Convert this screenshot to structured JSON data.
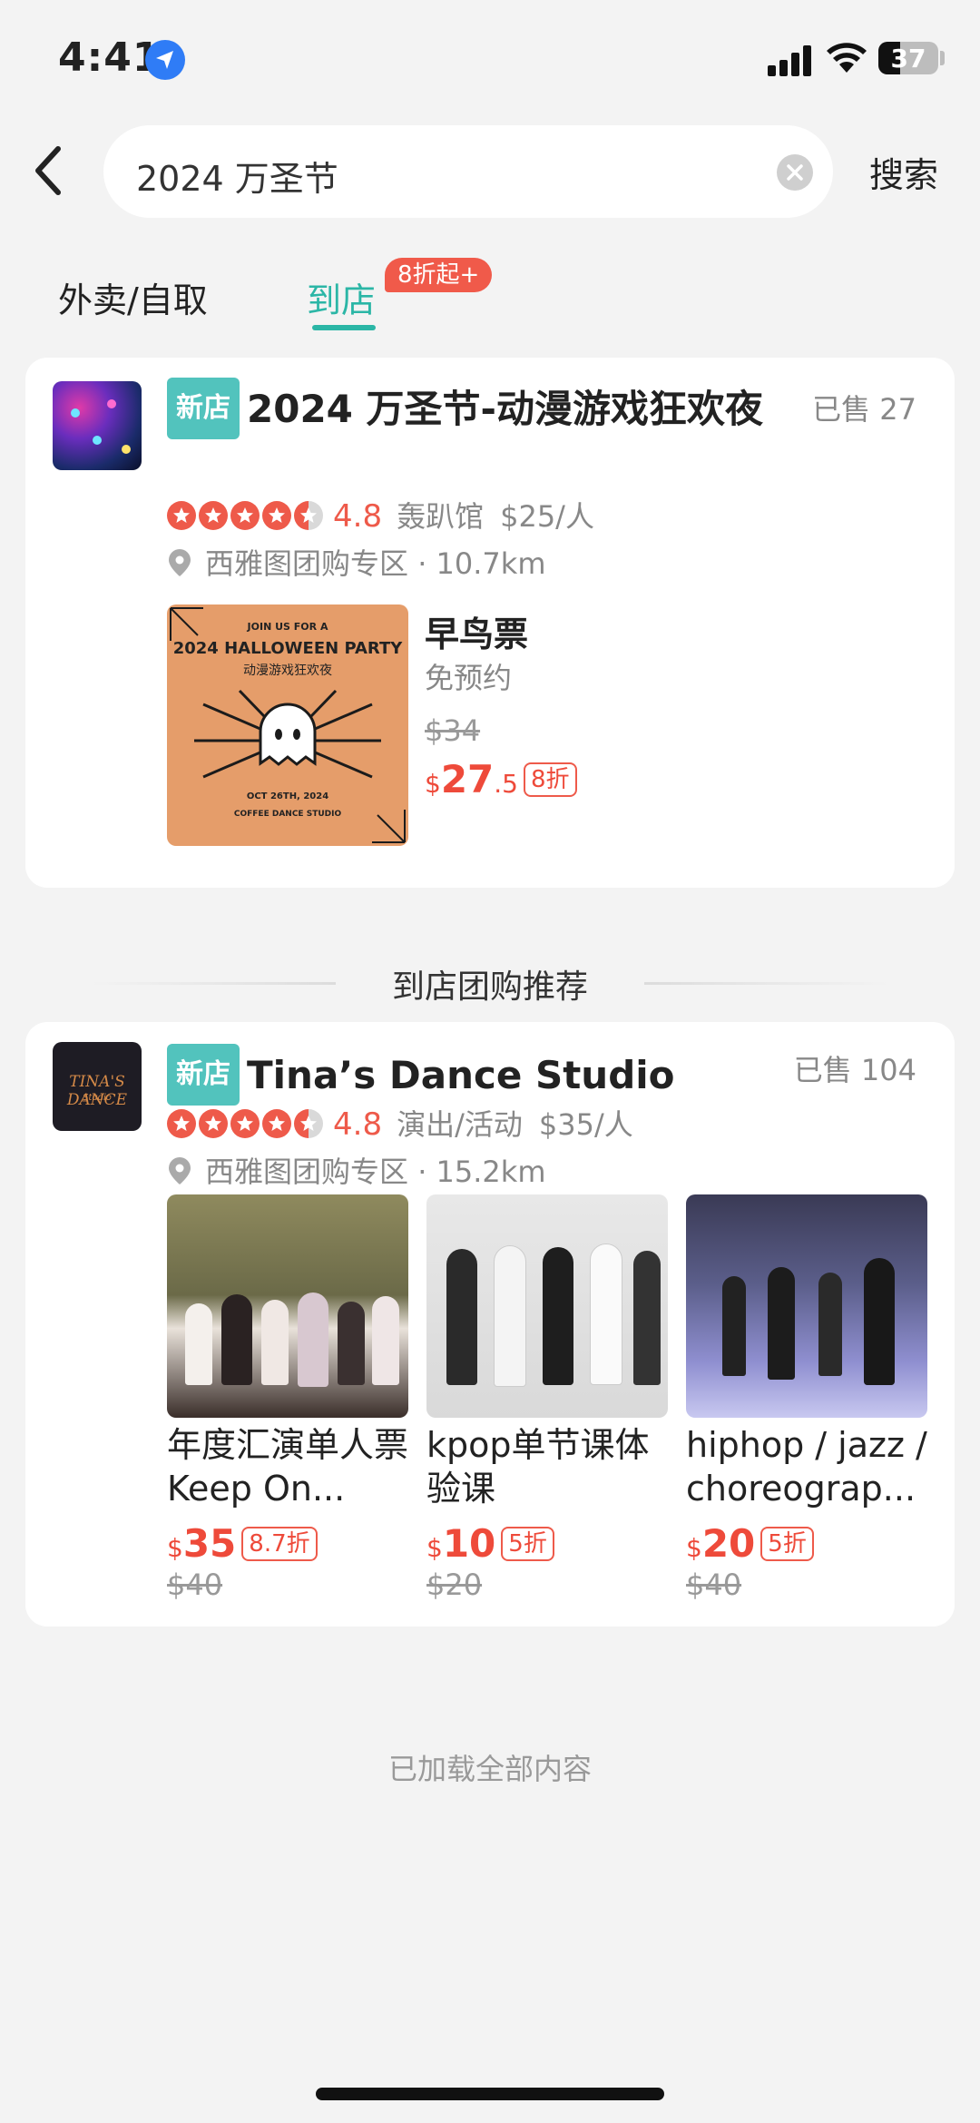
{
  "status_bar": {
    "time": "4:41",
    "battery": "37"
  },
  "search": {
    "query": "2024 万圣节",
    "button_label": "搜索"
  },
  "tabs": [
    {
      "label": "外卖/自取"
    },
    {
      "label": "到店",
      "badge": "8折起+"
    }
  ],
  "shop1": {
    "tag": "新店",
    "name": "2024 万圣节-动漫游戏狂欢夜",
    "sold": "已售 27",
    "rating": "4.8",
    "category": "轰趴馆",
    "price_per_person": "$25/人",
    "area": "西雅图团购专区",
    "distance": "· 10.7km",
    "poster": {
      "join": "JOIN US FOR A",
      "title": "2024 HALLOWEEN PARTY",
      "subtitle": "动漫游戏狂欢夜",
      "date": "OCT 26TH, 2024",
      "venue": "COFFEE DANCE STUDIO"
    },
    "deal": {
      "name": "早鸟票",
      "note": "免预约",
      "original_price": "$34",
      "currency": "$",
      "price_int": "27",
      "price_dec": ".5",
      "discount": "8折"
    }
  },
  "section_title": "到店团购推荐",
  "shop2": {
    "tag": "新店",
    "name": "Tina’s Dance Studio",
    "sold": "已售 104",
    "rating": "4.8",
    "category": "演出/活动",
    "price_per_person": "$35/人",
    "area": "西雅图团购专区",
    "distance": "· 15.2km",
    "logo_text": "TINA'S DANCE",
    "logo_sub": "Studio",
    "products": [
      {
        "name": "年度汇演单人票 Keep On...",
        "currency": "$",
        "price": "35",
        "discount": "8.7折",
        "original_price": "$40"
      },
      {
        "name": "kpop单节课体验课",
        "currency": "$",
        "price": "10",
        "discount": "5折",
        "original_price": "$20"
      },
      {
        "name": "hiphop / jazz / choreograp...",
        "currency": "$",
        "price": "20",
        "discount": "5折",
        "original_price": "$40"
      }
    ]
  },
  "footer": "已加载全部内容",
  "colors": {
    "accent": "#2bb6a6",
    "price_red": "#ee4a3a",
    "new_tag": "#52c3bd"
  }
}
